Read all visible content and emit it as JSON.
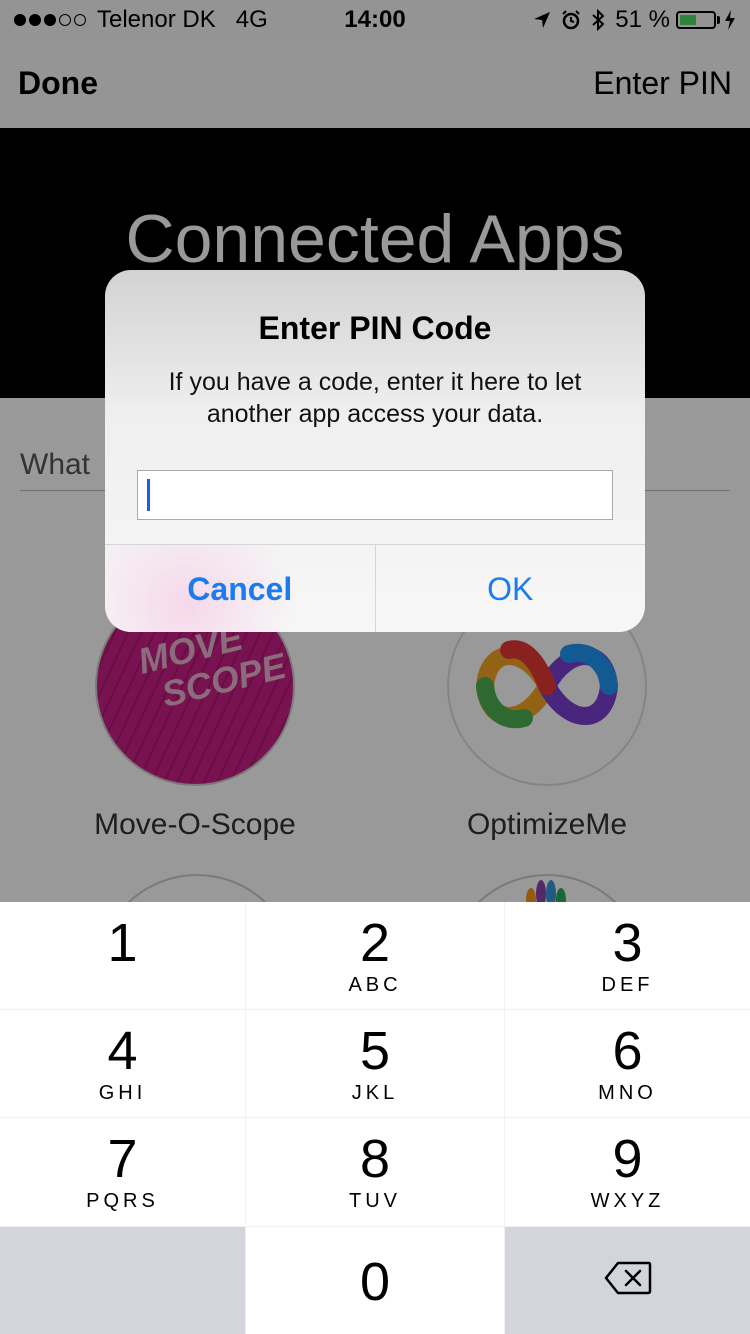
{
  "status_bar": {
    "carrier": "Telenor DK",
    "network": "4G",
    "time": "14:00",
    "battery_percent_label": "51 %",
    "battery_level": 0.51
  },
  "nav": {
    "left_label": "Done",
    "right_label": "Enter PIN"
  },
  "hero": {
    "title": "Connected Apps"
  },
  "search": {
    "placeholder": "What"
  },
  "apps": [
    {
      "name": "Move-O-Scope",
      "icon_text_line1": "MOVE",
      "icon_text_line2": "SCOPE",
      "icon": "move-o-scope-icon"
    },
    {
      "name": "OptimizeMe",
      "icon": "infinity-loop-icon"
    }
  ],
  "alert": {
    "title": "Enter PIN Code",
    "message": "If you have a code, enter it here to let another app access your data.",
    "input_value": "",
    "cancel_label": "Cancel",
    "ok_label": "OK",
    "accent_color": "#1a7cf0"
  },
  "keypad": {
    "keys": [
      {
        "num": "1",
        "letters": ""
      },
      {
        "num": "2",
        "letters": "ABC"
      },
      {
        "num": "3",
        "letters": "DEF"
      },
      {
        "num": "4",
        "letters": "GHI"
      },
      {
        "num": "5",
        "letters": "JKL"
      },
      {
        "num": "6",
        "letters": "MNO"
      },
      {
        "num": "7",
        "letters": "PQRS"
      },
      {
        "num": "8",
        "letters": "TUV"
      },
      {
        "num": "9",
        "letters": "WXYZ"
      },
      {
        "num": "0",
        "letters": ""
      }
    ],
    "delete_icon": "backspace-icon"
  }
}
